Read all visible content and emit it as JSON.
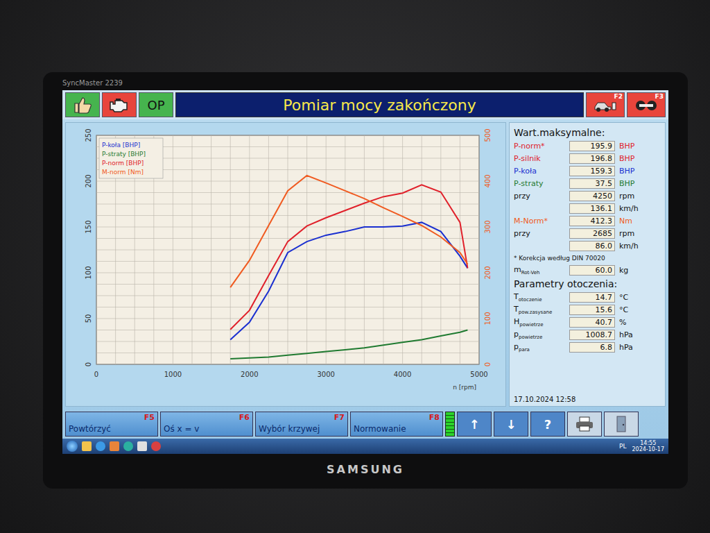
{
  "monitor": {
    "model": "SyncMaster 2239",
    "brand": "SAMSUNG"
  },
  "window": {
    "title": "Pomiar mocy zakończony"
  },
  "toolbar": {
    "op_label": "OP",
    "right_buttons": [
      {
        "key": "F2",
        "icon": "car"
      },
      {
        "key": "F3",
        "icon": "rollers"
      }
    ]
  },
  "chart": {
    "legend": [
      "P-koła [BHP]",
      "P-straty [BHP]",
      "P-norm [BHP]",
      "M-norm [Nm]"
    ],
    "x_axis": {
      "ticks": [
        "0",
        "1000",
        "2000",
        "3000",
        "4000",
        "5000"
      ],
      "label": "n [rpm]"
    },
    "y_left": {
      "ticks": [
        "0",
        "50",
        "100",
        "150",
        "200",
        "250"
      ]
    },
    "y_right": {
      "ticks": [
        "0",
        "100",
        "200",
        "300",
        "400",
        "500"
      ]
    },
    "rpm": [
      1750,
      2000,
      2250,
      2500,
      2750,
      3000,
      3250,
      3500,
      3750,
      4000,
      4250,
      4500,
      4750,
      4850
    ],
    "series": [
      {
        "name": "P-koła [BHP]",
        "axis": "left",
        "color": "#1a2fd0",
        "values": [
          27,
          46,
          80,
          122,
          134,
          141,
          145,
          150,
          150,
          151,
          155,
          145,
          118,
          105
        ]
      },
      {
        "name": "P-straty [BHP]",
        "axis": "left",
        "color": "#1f7a30",
        "values": [
          6,
          7,
          8,
          10,
          12,
          14,
          16,
          18,
          21,
          24,
          27,
          31,
          35,
          37.5
        ]
      },
      {
        "name": "P-norm [BHP]",
        "axis": "left",
        "color": "#e0202a",
        "values": [
          38,
          59,
          97,
          134,
          151,
          160,
          168,
          176,
          183,
          187,
          195.9,
          188,
          155,
          105
        ]
      },
      {
        "name": "M-norm [Nm]",
        "axis": "right",
        "color": "#f05a20",
        "values": [
          168,
          227,
          303,
          379,
          412.3,
          396,
          379,
          362,
          342,
          323,
          303,
          278,
          244,
          219
        ]
      }
    ]
  },
  "max_values": {
    "title": "Wart.maksymalne:",
    "rows": [
      {
        "label": "P-norm*",
        "sub": "",
        "value": "195.9",
        "unit": "BHP",
        "color": "#e0202a"
      },
      {
        "label": "P-silnik",
        "sub": "",
        "value": "196.8",
        "unit": "BHP",
        "color": "#e0202a"
      },
      {
        "label": "P-koła",
        "sub": "",
        "value": "159.3",
        "unit": "BHP",
        "color": "#1a2fd0"
      },
      {
        "label": "P-straty",
        "sub": "",
        "value": "37.5",
        "unit": "BHP",
        "color": "#1f7a30"
      },
      {
        "label": "przy",
        "sub": "",
        "value": "4250",
        "unit": "rpm",
        "color": "#111111"
      },
      {
        "label": "",
        "sub": "",
        "value": "136.1",
        "unit": "km/h",
        "color": "#111111"
      },
      {
        "label": "M-Norm*",
        "sub": "",
        "value": "412.3",
        "unit": "Nm",
        "color": "#f05a20"
      },
      {
        "label": "przy",
        "sub": "",
        "value": "2685",
        "unit": "rpm",
        "color": "#111111"
      },
      {
        "label": "",
        "sub": "",
        "value": "86.0",
        "unit": "km/h",
        "color": "#111111"
      }
    ],
    "note": "* Korekcja według DIN 70020",
    "mass": {
      "label": "m",
      "sub": "Rot-Veh",
      "value": "60.0",
      "unit": "kg"
    }
  },
  "ambient": {
    "title": "Parametry otoczenia:",
    "rows": [
      {
        "label": "T",
        "sub": "otoczenie",
        "value": "14.7",
        "unit": "°C"
      },
      {
        "label": "T",
        "sub": "pow.zasysane",
        "value": "15.6",
        "unit": "°C"
      },
      {
        "label": "H",
        "sub": "powietrze",
        "value": "40.7",
        "unit": "%"
      },
      {
        "label": "p",
        "sub": "powietrze",
        "value": "1008.7",
        "unit": "hPa"
      },
      {
        "label": "p",
        "sub": "para",
        "value": "6.8",
        "unit": "hPa"
      }
    ]
  },
  "timestamp": "17.10.2024   12:58",
  "function_keys": [
    {
      "label": "Powtórzyć",
      "key": "F5"
    },
    {
      "label": "Oś x = v",
      "key": "F6"
    },
    {
      "label": "Wybór krzywej",
      "key": "F7"
    },
    {
      "label": "Normowanie",
      "key": "F8"
    }
  ],
  "status_indicator": {
    "level": 1.0
  },
  "nav_buttons": [
    "↑",
    "↓",
    "?"
  ],
  "taskbar": {
    "language": "PL",
    "time": "14:55",
    "date": "2024-10-17"
  }
}
